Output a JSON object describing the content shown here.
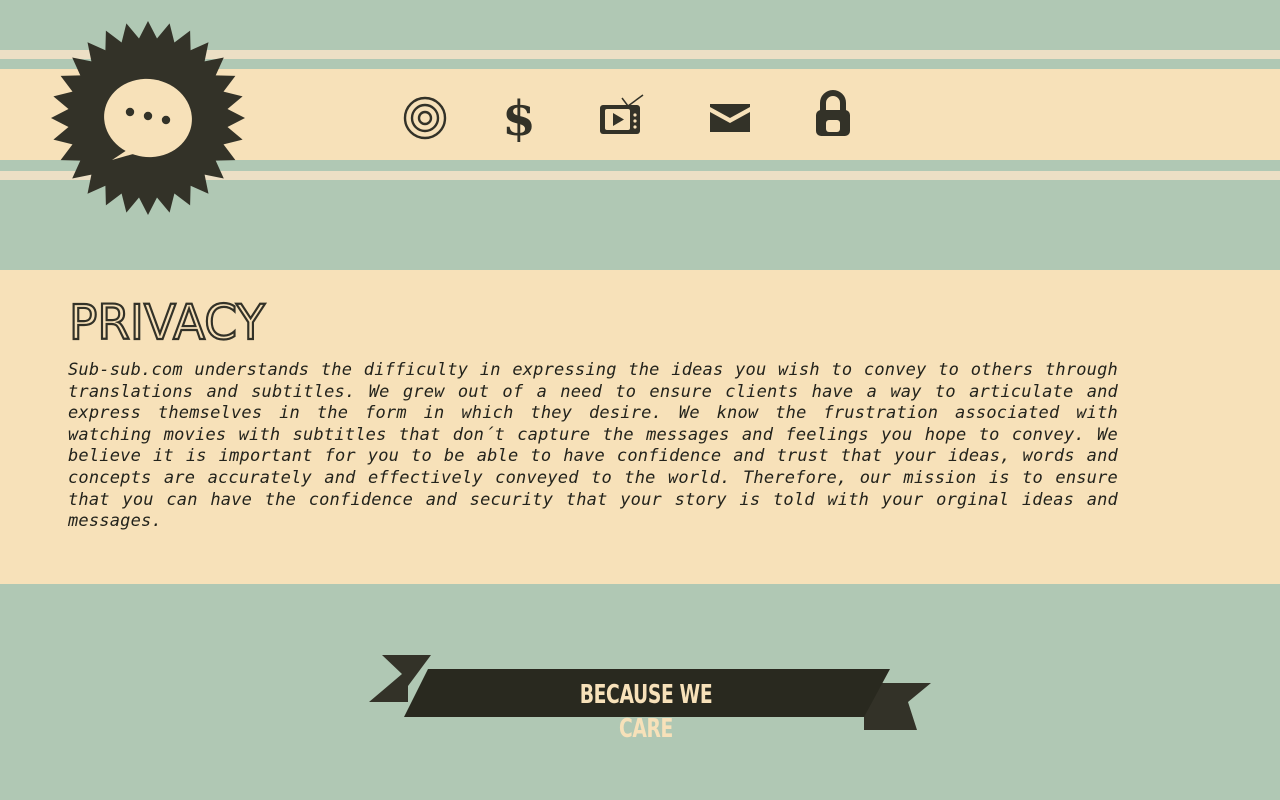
{
  "site": {
    "logo_icon": "speech-bubble-icon",
    "colors": {
      "background": "#b0c8b4",
      "cream": "#f7e1b9",
      "stripe": "#ecdfc5",
      "dark": "#333228"
    }
  },
  "nav": {
    "items": [
      {
        "icon": "target-icon"
      },
      {
        "icon": "dollar-icon"
      },
      {
        "icon": "tv-play-icon"
      },
      {
        "icon": "envelope-icon"
      },
      {
        "icon": "padlock-icon"
      }
    ]
  },
  "content": {
    "title": "PRIVACY",
    "body": "Sub-sub.com understands the difficulty in expressing the ideas you wish to convey to others through translations and subtitles.  We grew out of a need to ensure clients have  a way to articulate and express themselves in the form in which they desire.  We know the frustration associated with watching movies with subtitles that don´t capture the messages and feelings you hope to convey.  We believe it is important for you to be able to have confidence and trust that your ideas, words and concepts are accurately and effectively conveyed to the world. Therefore, our mission is to ensure that you can have the confidence and security that your story is told with your orginal ideas and messages."
  },
  "banner": {
    "label": "BECAUSE WE CARE"
  }
}
